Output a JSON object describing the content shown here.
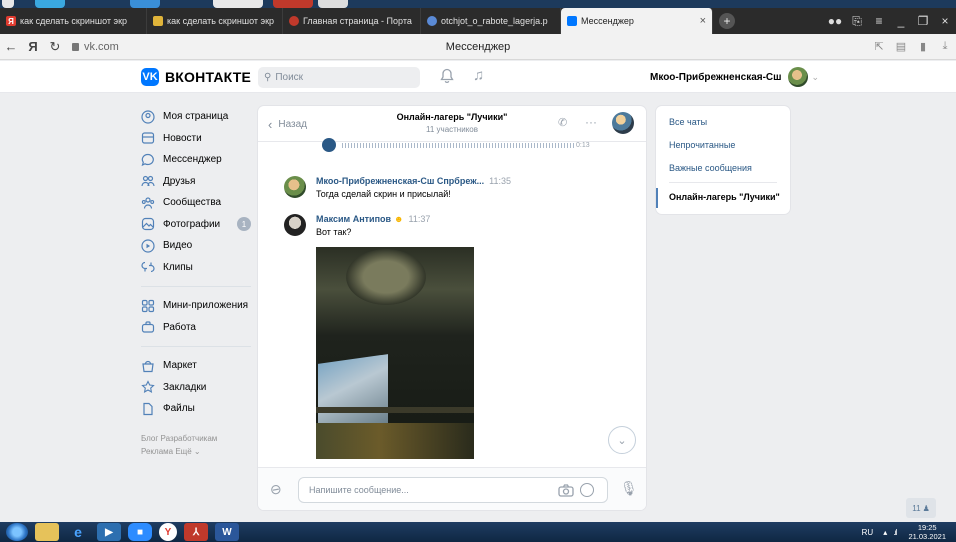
{
  "browser": {
    "tabs": [
      {
        "label": "как сделать скриншот экр",
        "favicon": "yandex-icon",
        "color": "#e03b2f",
        "active": false
      },
      {
        "label": "как сделать скриншот экр",
        "favicon": "video-icon",
        "color": "#e0b43a",
        "active": false
      },
      {
        "label": "Главная страница - Порта",
        "favicon": "portal-icon",
        "color": "#c0392b",
        "active": false
      },
      {
        "label": "otchjot_o_rabote_lagerja.p",
        "favicon": "globe-icon",
        "color": "#5a8ad6",
        "active": false
      },
      {
        "label": "Мессенджер",
        "favicon": "vk-icon",
        "color": "#0077ff",
        "active": true
      }
    ],
    "url": "vk.com",
    "page_title": "Мессенджер"
  },
  "vk": {
    "logo_text": "ВКОНТАКТЕ",
    "search_placeholder": "Поиск",
    "profile_name": "Мкоо-Прибрежненская-Сш",
    "menu": [
      {
        "label": "Моя страница",
        "icon": "user-icon"
      },
      {
        "label": "Новости",
        "icon": "news-icon"
      },
      {
        "label": "Мессенджер",
        "icon": "chat-icon"
      },
      {
        "label": "Друзья",
        "icon": "friends-icon"
      },
      {
        "label": "Сообщества",
        "icon": "communities-icon"
      },
      {
        "label": "Фотографии",
        "icon": "photo-icon",
        "badge": "1"
      },
      {
        "label": "Видео",
        "icon": "video-icon"
      },
      {
        "label": "Клипы",
        "icon": "clips-icon"
      },
      {
        "label": "Мини-приложения",
        "icon": "apps-icon"
      },
      {
        "label": "Работа",
        "icon": "work-icon"
      },
      {
        "label": "Маркет",
        "icon": "market-icon"
      },
      {
        "label": "Закладки",
        "icon": "bookmark-icon"
      },
      {
        "label": "Файлы",
        "icon": "files-icon"
      }
    ],
    "footer": {
      "line1": "Блог  Разработчикам",
      "line2": "Реклама  Ещё ⌄"
    }
  },
  "chat": {
    "back_label": "Назад",
    "title": "Онлайн-лагерь \"Лучики\"",
    "subtitle": "11 участников",
    "audio_duration": "0:13",
    "messages": [
      {
        "author": "Мкоо-Прибрежненская-Сш Спрбреж...",
        "time": "11:35",
        "text": "Тогда сделай скрин и присылай!"
      },
      {
        "author": "Максим Антипов",
        "time": "11:37",
        "text": "Вот так?"
      }
    ],
    "composer_placeholder": "Напишите сообщение..."
  },
  "right_panel": {
    "items": [
      "Все чаты",
      "Непрочитанные",
      "Важные сообщения"
    ],
    "active_chat": "Онлайн-лагерь \"Лучики\""
  },
  "notification_badge": "11",
  "taskbar": {
    "lang": "RU",
    "time": "19:25",
    "date": "21.03.2021"
  },
  "colors": {
    "vk_blue": "#0077ff",
    "link": "#2a5885",
    "background": "#edeef0"
  }
}
